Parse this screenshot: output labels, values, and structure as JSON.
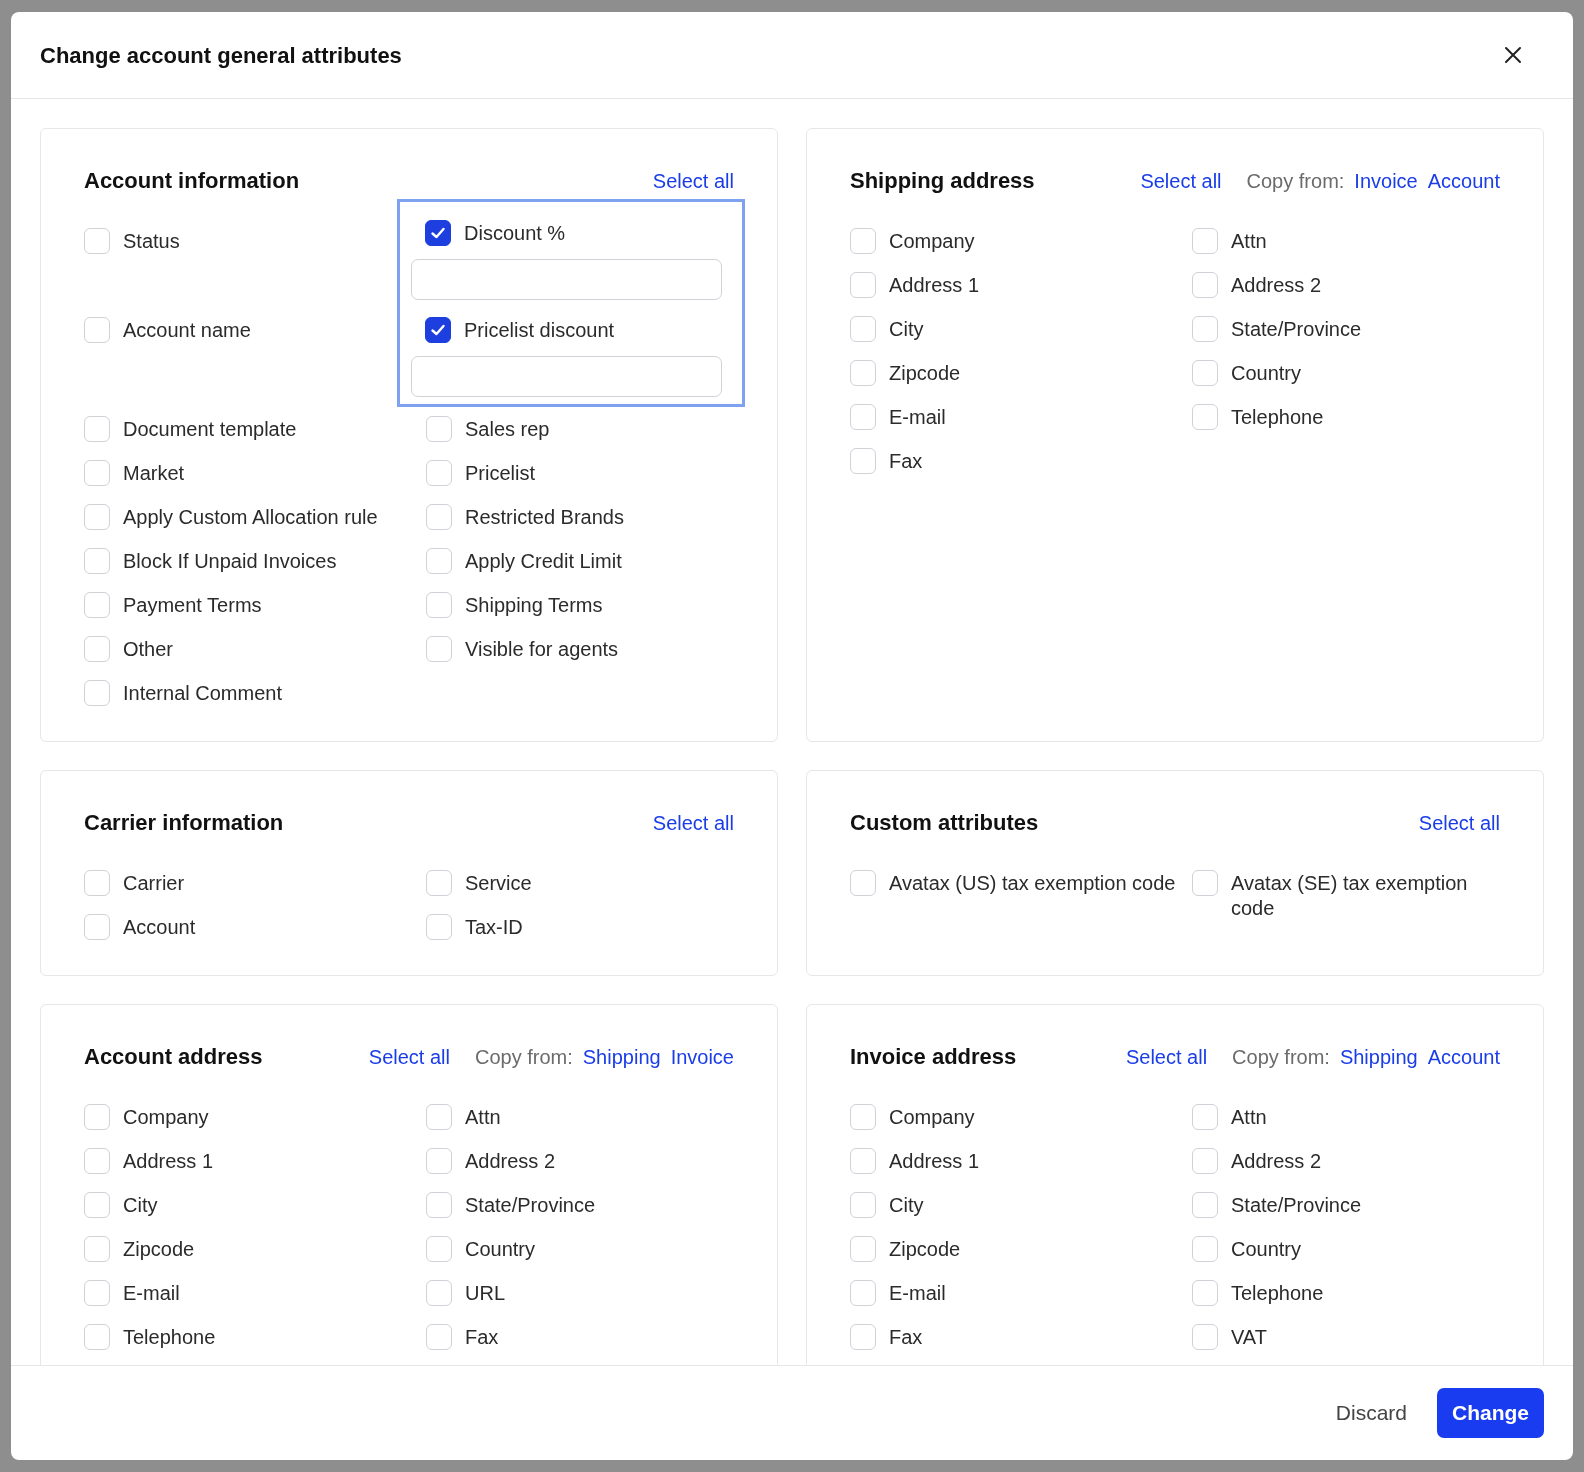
{
  "dialog": {
    "title": "Change account general attributes"
  },
  "sections": [
    {
      "title": "Account information",
      "select_all": "Select all",
      "items": [
        {
          "kind": "checkbox",
          "label": "Status",
          "checked": false
        },
        {
          "kind": "checkbox_field",
          "label": "Discount %",
          "checked": true,
          "focused": true
        },
        {
          "kind": "checkbox",
          "label": "Account name",
          "checked": false
        },
        {
          "kind": "checkbox_field",
          "label": "Pricelist discount",
          "checked": true,
          "focused": true
        },
        {
          "kind": "checkbox",
          "label": "Document template",
          "checked": false
        },
        {
          "kind": "checkbox",
          "label": "Sales rep",
          "checked": false
        },
        {
          "kind": "checkbox",
          "label": "Market",
          "checked": false
        },
        {
          "kind": "checkbox",
          "label": "Pricelist",
          "checked": false
        },
        {
          "kind": "checkbox",
          "label": "Apply Custom Allocation rule",
          "checked": false
        },
        {
          "kind": "checkbox",
          "label": "Restricted Brands",
          "checked": false
        },
        {
          "kind": "checkbox",
          "label": "Block If Unpaid Invoices",
          "checked": false
        },
        {
          "kind": "checkbox",
          "label": "Apply Credit Limit",
          "checked": false
        },
        {
          "kind": "checkbox",
          "label": "Payment Terms",
          "checked": false
        },
        {
          "kind": "checkbox",
          "label": "Shipping Terms",
          "checked": false
        },
        {
          "kind": "checkbox",
          "label": "Other",
          "checked": false
        },
        {
          "kind": "checkbox",
          "label": "Visible for agents",
          "checked": false
        },
        {
          "kind": "checkbox",
          "label": "Internal Comment",
          "checked": false
        }
      ]
    },
    {
      "title": "Shipping address",
      "select_all": "Select all",
      "copy_from": {
        "label": "Copy from:",
        "links": [
          "Invoice",
          "Account"
        ]
      },
      "items": [
        {
          "kind": "checkbox",
          "label": "Company",
          "checked": false
        },
        {
          "kind": "checkbox",
          "label": "Attn",
          "checked": false
        },
        {
          "kind": "checkbox",
          "label": "Address 1",
          "checked": false
        },
        {
          "kind": "checkbox",
          "label": "Address 2",
          "checked": false
        },
        {
          "kind": "checkbox",
          "label": "City",
          "checked": false
        },
        {
          "kind": "checkbox",
          "label": "State/Province",
          "checked": false
        },
        {
          "kind": "checkbox",
          "label": "Zipcode",
          "checked": false
        },
        {
          "kind": "checkbox",
          "label": "Country",
          "checked": false
        },
        {
          "kind": "checkbox",
          "label": "E-mail",
          "checked": false
        },
        {
          "kind": "checkbox",
          "label": "Telephone",
          "checked": false
        },
        {
          "kind": "checkbox",
          "label": "Fax",
          "checked": false
        }
      ]
    },
    {
      "title": "Carrier information",
      "select_all": "Select all",
      "items": [
        {
          "kind": "checkbox",
          "label": "Carrier",
          "checked": false
        },
        {
          "kind": "checkbox",
          "label": "Service",
          "checked": false
        },
        {
          "kind": "checkbox",
          "label": "Account",
          "checked": false
        },
        {
          "kind": "checkbox",
          "label": "Tax-ID",
          "checked": false
        }
      ]
    },
    {
      "title": "Custom attributes",
      "select_all": "Select all",
      "items": [
        {
          "kind": "checkbox",
          "label": "Avatax (US) tax exemption code",
          "checked": false
        },
        {
          "kind": "checkbox",
          "label": "Avatax (SE) tax exemption code",
          "checked": false
        }
      ]
    },
    {
      "title": "Account address",
      "select_all": "Select all",
      "copy_from": {
        "label": "Copy from:",
        "links": [
          "Shipping",
          "Invoice"
        ]
      },
      "items": [
        {
          "kind": "checkbox",
          "label": "Company",
          "checked": false
        },
        {
          "kind": "checkbox",
          "label": "Attn",
          "checked": false
        },
        {
          "kind": "checkbox",
          "label": "Address 1",
          "checked": false
        },
        {
          "kind": "checkbox",
          "label": "Address 2",
          "checked": false
        },
        {
          "kind": "checkbox",
          "label": "City",
          "checked": false
        },
        {
          "kind": "checkbox",
          "label": "State/Province",
          "checked": false
        },
        {
          "kind": "checkbox",
          "label": "Zipcode",
          "checked": false
        },
        {
          "kind": "checkbox",
          "label": "Country",
          "checked": false
        },
        {
          "kind": "checkbox",
          "label": "E-mail",
          "checked": false
        },
        {
          "kind": "checkbox",
          "label": "URL",
          "checked": false
        },
        {
          "kind": "checkbox",
          "label": "Telephone",
          "checked": false
        },
        {
          "kind": "checkbox",
          "label": "Fax",
          "checked": false
        }
      ]
    },
    {
      "title": "Invoice address",
      "select_all": "Select all",
      "copy_from": {
        "label": "Copy from:",
        "links": [
          "Shipping",
          "Account"
        ]
      },
      "items": [
        {
          "kind": "checkbox",
          "label": "Company",
          "checked": false
        },
        {
          "kind": "checkbox",
          "label": "Attn",
          "checked": false
        },
        {
          "kind": "checkbox",
          "label": "Address 1",
          "checked": false
        },
        {
          "kind": "checkbox",
          "label": "Address 2",
          "checked": false
        },
        {
          "kind": "checkbox",
          "label": "City",
          "checked": false
        },
        {
          "kind": "checkbox",
          "label": "State/Province",
          "checked": false
        },
        {
          "kind": "checkbox",
          "label": "Zipcode",
          "checked": false
        },
        {
          "kind": "checkbox",
          "label": "Country",
          "checked": false
        },
        {
          "kind": "checkbox",
          "label": "E-mail",
          "checked": false
        },
        {
          "kind": "checkbox",
          "label": "Telephone",
          "checked": false
        },
        {
          "kind": "checkbox",
          "label": "Fax",
          "checked": false
        },
        {
          "kind": "checkbox",
          "label": "VAT",
          "checked": false
        }
      ]
    }
  ],
  "footer": {
    "buttons": [
      {
        "kind": "secondary",
        "label": "Discard"
      },
      {
        "kind": "primary",
        "label": "Change"
      }
    ]
  }
}
